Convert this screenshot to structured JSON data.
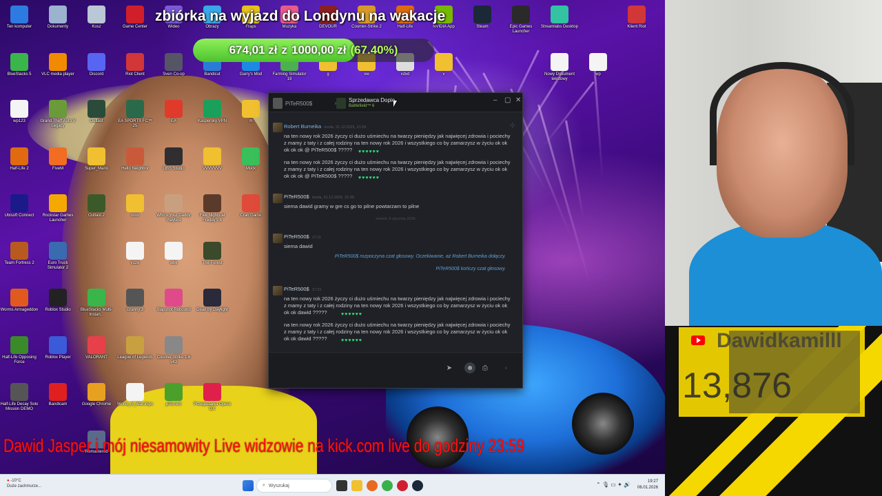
{
  "goal": {
    "title": "zbiórka na wyjazd do Londynu na wakacje",
    "current": "674,01 zł",
    "connector": "z",
    "target": "1000,00 zł",
    "percent_label": "(67.40%)",
    "progress_fraction": 0.674
  },
  "ticker": {
    "text": "Dawid Jasper i mój niesamowity Live widzowie na     kick.com  live do godziny 23:59"
  },
  "desktop_icons": [
    {
      "label": "Ten komputer",
      "icon": "computer-icon",
      "color": "#2d7be0",
      "col": 0,
      "row": 0
    },
    {
      "label": "Dokumenty",
      "icon": "documents-icon",
      "color": "#9bb3cf",
      "col": 1,
      "row": 0
    },
    {
      "label": "Kosz",
      "icon": "recycle-bin-icon",
      "color": "#b9c7d6",
      "col": 2,
      "row": 0
    },
    {
      "label": "Game Center",
      "icon": "game-center-icon",
      "color": "#d01f2a",
      "col": 3,
      "row": 0
    },
    {
      "label": "Wideo",
      "icon": "video-folder-icon",
      "color": "#7a5ad8",
      "col": 4,
      "row": 0
    },
    {
      "label": "Obrazy",
      "icon": "pictures-folder-icon",
      "color": "#39a8e8",
      "col": 5,
      "row": 0
    },
    {
      "label": "Fraps",
      "icon": "fraps-icon",
      "color": "#e8c21a",
      "col": 6,
      "row": 0
    },
    {
      "label": "Muzyka",
      "icon": "music-folder-icon",
      "color": "#e85a8a",
      "col": 7,
      "row": 0
    },
    {
      "label": "DEVOUR",
      "icon": "devour-icon",
      "color": "#8a2020",
      "col": 8,
      "row": 0
    },
    {
      "label": "Counter-Strike 2",
      "icon": "cs2-icon",
      "color": "#d79a2a",
      "col": 9,
      "row": 0
    },
    {
      "label": "Half-Life",
      "icon": "half-life-icon",
      "color": "#e06a10",
      "col": 10,
      "row": 0
    },
    {
      "label": "NVIDIA App",
      "icon": "nvidia-icon",
      "color": "#76b900",
      "col": 11,
      "row": 0
    },
    {
      "label": "Steam",
      "icon": "steam-icon",
      "color": "#1b2838",
      "col": 12,
      "row": 0
    },
    {
      "label": "Epic Games Launcher",
      "icon": "epic-games-icon",
      "color": "#2a2a2a",
      "col": 13,
      "row": 0
    },
    {
      "label": "Streamlabs Desktop",
      "icon": "streamlabs-icon",
      "color": "#31c3a2",
      "col": 14,
      "row": 0
    },
    {
      "label": "Klient Riot",
      "icon": "riot-client-icon",
      "color": "#d13639",
      "col": 16,
      "row": 0
    },
    {
      "label": "BlueStacks 5",
      "icon": "bluestacks-icon",
      "color": "#3ab54a",
      "col": 0,
      "row": 1
    },
    {
      "label": "VLC media player",
      "icon": "vlc-icon",
      "color": "#f08a00",
      "col": 1,
      "row": 1
    },
    {
      "label": "Discord",
      "icon": "discord-icon",
      "color": "#5865f2",
      "col": 2,
      "row": 1
    },
    {
      "label": "Riot Client",
      "icon": "riot-client-icon",
      "color": "#d13639",
      "col": 3,
      "row": 1
    },
    {
      "label": "Sven Co-op",
      "icon": "sven-coop-icon",
      "color": "#556",
      "col": 4,
      "row": 1
    },
    {
      "label": "Bandicut",
      "icon": "bandicut-icon",
      "color": "#2a7bd8",
      "col": 5,
      "row": 1
    },
    {
      "label": "Garry's Mod",
      "icon": "garrys-mod-icon",
      "color": "#1e88e5",
      "col": 6,
      "row": 1
    },
    {
      "label": "Farming Simulator 19",
      "icon": "farming-sim-icon",
      "color": "#4caf50",
      "col": 7,
      "row": 1
    },
    {
      "label": "g",
      "icon": "folder-icon",
      "color": "#f0c030",
      "col": 8,
      "row": 1
    },
    {
      "label": "vie",
      "icon": "folder-icon",
      "color": "#f0c030",
      "col": 9,
      "row": 1
    },
    {
      "label": "xdxd",
      "icon": "file-icon",
      "color": "#ddd",
      "col": 10,
      "row": 1
    },
    {
      "label": "v",
      "icon": "folder-icon",
      "color": "#f0c030",
      "col": 11,
      "row": 1
    },
    {
      "label": "Nowy Dokument tekstowy",
      "icon": "text-file-icon",
      "color": "#f4f4f4",
      "col": 14,
      "row": 1
    },
    {
      "label": "wp",
      "icon": "text-file-icon",
      "color": "#f4f4f4",
      "col": 15,
      "row": 1
    },
    {
      "label": "wp123",
      "icon": "text-file-icon",
      "color": "#f4f4f4",
      "col": 0,
      "row": 2
    },
    {
      "label": "Grand Theft Auto V Legacy",
      "icon": "gta-icon",
      "color": "#6a9a3a",
      "col": 1,
      "row": 2
    },
    {
      "label": "Outlast",
      "icon": "outlast-icon",
      "color": "#2a4a3a",
      "col": 2,
      "row": 2
    },
    {
      "label": "EA SPORTS FC™ 25",
      "icon": "ea-fc-icon",
      "color": "#2a6a4a",
      "col": 3,
      "row": 2
    },
    {
      "label": "EA",
      "icon": "ea-icon",
      "color": "#e03a2a",
      "col": 4,
      "row": 2
    },
    {
      "label": "Kaspersky VPN",
      "icon": "kaspersky-icon",
      "color": "#1aa05a",
      "col": 5,
      "row": 2
    },
    {
      "label": "m",
      "icon": "folder-icon",
      "color": "#f0c030",
      "col": 6,
      "row": 2
    },
    {
      "label": "Half-Life 2",
      "icon": "half-life-2-icon",
      "color": "#e06a10",
      "col": 0,
      "row": 3
    },
    {
      "label": "FiveM",
      "icon": "fivem-icon",
      "color": "#f26c22",
      "col": 1,
      "row": 3
    },
    {
      "label": "Super_Mario",
      "icon": "folder-icon",
      "color": "#f0c030",
      "col": 2,
      "row": 3
    },
    {
      "label": "Hello Neighbor",
      "icon": "hello-neighbor-icon",
      "color": "#c85a3a",
      "col": 3,
      "row": 3
    },
    {
      "label": "OBS Studio",
      "icon": "obs-icon",
      "color": "#302e31",
      "col": 4,
      "row": 3
    },
    {
      "label": "VVVVVVV",
      "icon": "folder-icon",
      "color": "#f0c030",
      "col": 5,
      "row": 3
    },
    {
      "label": "Muck",
      "icon": "muck-icon",
      "color": "#3ac05a",
      "col": 6,
      "row": 3
    },
    {
      "label": "Ubisoft Connect",
      "icon": "ubisoft-icon",
      "color": "#1a1a8a",
      "col": 0,
      "row": 4
    },
    {
      "label": "Rockstar Games Launcher",
      "icon": "rockstar-icon",
      "color": "#f4a900",
      "col": 1,
      "row": 4
    },
    {
      "label": "Outlast 2",
      "icon": "outlast-2-icon",
      "color": "#3a5a2a",
      "col": 2,
      "row": 4
    },
    {
      "label": "vvvv",
      "icon": "folder-icon",
      "color": "#f0c030",
      "col": 3,
      "row": 4
    },
    {
      "label": "Who's Your Daddy Playtest",
      "icon": "whos-your-daddy-icon",
      "color": "#c8a080",
      "col": 4,
      "row": 4
    },
    {
      "label": "Five Nights at Freddy's 4",
      "icon": "fnaf-icon",
      "color": "#5a3a2a",
      "col": 5,
      "row": 4
    },
    {
      "label": "Crab Game",
      "icon": "crab-game-icon",
      "color": "#e04a3a",
      "col": 6,
      "row": 4
    },
    {
      "label": "Team Fortress 2",
      "icon": "tf2-icon",
      "color": "#b85a20",
      "col": 0,
      "row": 5
    },
    {
      "label": "Euro Truck Simulator 2",
      "icon": "ets2-icon",
      "color": "#3a6ab0",
      "col": 1,
      "row": 5
    },
    {
      "label": "vuze",
      "icon": "text-file-icon",
      "color": "#f4f4f4",
      "col": 3,
      "row": 5
    },
    {
      "label": "wbk",
      "icon": "text-file-icon",
      "color": "#f4f4f4",
      "col": 4,
      "row": 5
    },
    {
      "label": "The Forest",
      "icon": "the-forest-icon",
      "color": "#3a4a2a",
      "col": 5,
      "row": 5
    },
    {
      "label": "Worms Armageddon",
      "icon": "worms-icon",
      "color": "#e05a20",
      "col": 0,
      "row": 6
    },
    {
      "label": "Roblox Studio",
      "icon": "roblox-studio-icon",
      "color": "#222",
      "col": 1,
      "row": 6
    },
    {
      "label": "BlueStacks Multi-Instan...",
      "icon": "bluestacks-multi-icon",
      "color": "#3ab54a",
      "col": 2,
      "row": 6
    },
    {
      "label": "Granny 3",
      "icon": "granny-icon",
      "color": "#555",
      "col": 3,
      "row": 6
    },
    {
      "label": "Slapshot Rebound",
      "icon": "slapshot-icon",
      "color": "#e04a8a",
      "col": 4,
      "row": 6
    },
    {
      "label": "Dead by Daylight",
      "icon": "dbd-icon",
      "color": "#2a2a3a",
      "col": 5,
      "row": 6
    },
    {
      "label": "Half-Life Opposing Force",
      "icon": "hl-opfor-icon",
      "color": "#3a8a2a",
      "col": 0,
      "row": 7
    },
    {
      "label": "Roblox Player",
      "icon": "roblox-player-icon",
      "color": "#3a5ad8",
      "col": 1,
      "row": 7
    },
    {
      "label": "VALORANT",
      "icon": "valorant-icon",
      "color": "#e8404a",
      "col": 2,
      "row": 7
    },
    {
      "label": "League of Legends",
      "icon": "lol-icon",
      "color": "#c8a040",
      "col": 3,
      "row": 7
    },
    {
      "label": "Counter-Strike 1.6 v43",
      "icon": "cs16-icon",
      "color": "#888",
      "col": 4,
      "row": 7
    },
    {
      "label": "Half-Life Decay Solo Mission DEMO",
      "icon": "hl-decay-icon",
      "color": "#555",
      "col": 0,
      "row": 8
    },
    {
      "label": "Bandicam",
      "icon": "bandicam-icon",
      "color": "#e02020",
      "col": 1,
      "row": 8
    },
    {
      "label": "Google Chrome",
      "icon": "chrome-icon",
      "color": "#e8a020",
      "col": 2,
      "row": 8
    },
    {
      "label": "World_of_Warships",
      "icon": "text-file-icon",
      "color": "#f4f4f4",
      "col": 3,
      "row": 8
    },
    {
      "label": "µTorrent",
      "icon": "utorrent-icon",
      "color": "#4aa02a",
      "col": 4,
      "row": 8
    },
    {
      "label": "Przeglądarka Opera GX",
      "icon": "opera-gx-icon",
      "color": "#e0204a",
      "col": 5,
      "row": 8
    },
    {
      "label": "Remastered",
      "icon": "remastered-icon",
      "color": "#5a6a8a",
      "col": 2,
      "row": 9
    }
  ],
  "chat": {
    "tabs": [
      {
        "name": "PiTeR500$",
        "sub": ""
      },
      {
        "name": "Sprzedawca Dopie",
        "sub": "Battlefield™ 6"
      }
    ],
    "messages": [
      {
        "author": "Robert Burneika",
        "time": "środa, 31.12.2025, 21:09",
        "lines": [
          "na ten nowy rok 2026 życzy ci dużo uśmiechu na twarzy pieniędzy jak najwięcej zdrowia i pociechy z mamy z taty i z całej rodziny na ten nowy rok 2026 i wszystkiego co by zamarzysz w życiu ok ok ok ok ok @ PiTeR500$ ?????",
          "na ten nowy rok 2026 życzy ci dużo uśmiechu na twarzy pieniędzy jak najwięcej zdrowia i pociechy z mamy z taty i z całej rodziny na ten nowy rok 2026 i wszystkiego co by zamarzysz w życiu ok ok ok ok ok @ PiTeR500$ ?????"
        ],
        "hearts": "♥♥♥♥♥♥"
      },
      {
        "author": "PiTeR500$",
        "time": "środa, 31.12.2025, 21:09",
        "lines": [
          "siema dawid gramy w gre cs go to pilne powtarzam to pilne"
        ]
      },
      {
        "separator": "wtorek, 6 stycznia 2026"
      },
      {
        "author": "PiTeR500$",
        "time": "17:11",
        "lines": [
          "siema dawid"
        ]
      },
      {
        "system": "PiTeR500$ rozpoczyna czat głosowy. Oczekiwanie, aż Robert Burneika dołączy."
      },
      {
        "system": "PiTeR500$ kończy czat głosowy."
      },
      {
        "author": "PiTeR500$",
        "time": "17:21",
        "lines": [
          "na ten nowy rok 2026 życzy ci dużo uśmiechu na twarzy pieniędzy jak najwięcej zdrowia i pociechy z mamy z taty i z całej rodziny na ten nowy rok 2026 i wszystkiego co by zamarzysz w życiu ok ok ok ok dawid ?????",
          "na ten nowy rok 2026 życzy ci dużo uśmiechu na twarzy pieniędzy jak najwięcej zdrowia i pociechy z mamy z taty i z całej rodziny na ten nowy rok 2026 i wszystkiego co by zamarzysz w życiu ok ok ok ok dawid ?????"
        ],
        "hearts": "♥♥♥♥♥♥"
      }
    ]
  },
  "counter": {
    "channel": "Dawidkamilll",
    "subs": "13,876"
  },
  "taskbar": {
    "weather_temp": "-10°C",
    "weather_desc": "Duże zachmurze...",
    "search_placeholder": "Wyszukaj",
    "time": "19:27",
    "date": "06.01.2026"
  }
}
